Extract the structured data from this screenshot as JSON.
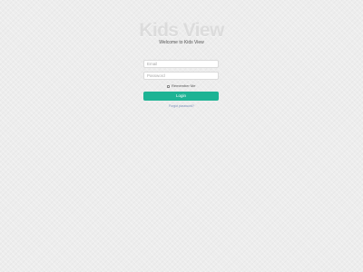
{
  "brand": {
    "title": "Kids View",
    "welcome": "Welcome to Kids View"
  },
  "form": {
    "email_placeholder": "Email",
    "email_value": "",
    "password_placeholder": "Password",
    "password_value": "",
    "remember_label": "Remember Me",
    "remember_checked": false,
    "login_label": "Login",
    "forgot_label": "Forgot password?"
  },
  "colors": {
    "background": "#ededed",
    "title": "#dcdcdc",
    "accent": "#1db394",
    "link": "#7a8fb8"
  }
}
